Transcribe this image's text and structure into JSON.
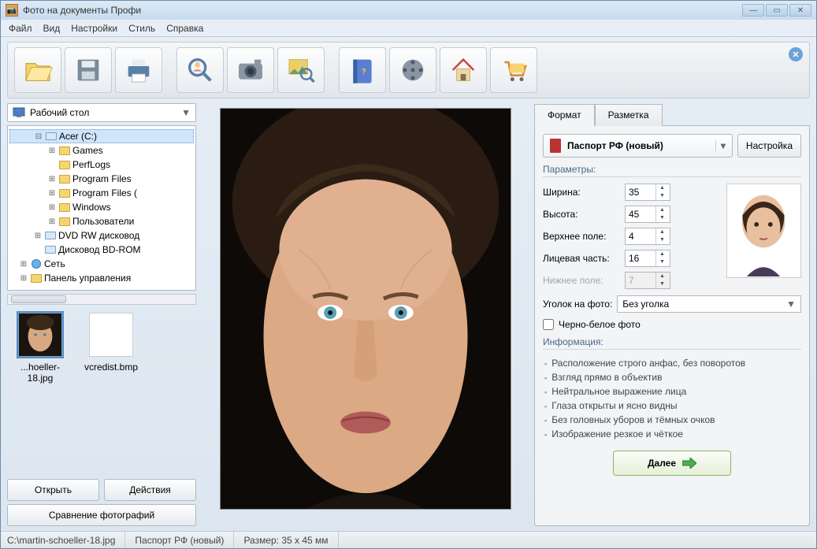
{
  "window": {
    "title": "Фото на документы Профи"
  },
  "menu": {
    "file": "Файл",
    "view": "Вид",
    "settings": "Настройки",
    "style": "Стиль",
    "help": "Справка"
  },
  "location_combo": {
    "label": "Рабочий стол"
  },
  "tree": {
    "acer": "Acer (C:)",
    "games": "Games",
    "perflogs": "PerfLogs",
    "progfiles": "Program Files",
    "progfilesx": "Program Files (",
    "windows": "Windows",
    "users": "Пользователи",
    "dvd": "DVD RW дисковод",
    "bd": "Дисковод BD-ROM",
    "network": "Сеть",
    "control": "Панель управления"
  },
  "thumbs": {
    "file1": "...hoeller-18.jpg",
    "file2": "vcredist.bmp"
  },
  "buttons": {
    "open": "Открыть",
    "actions": "Действия",
    "compare": "Сравнение фотографий"
  },
  "tabs": {
    "format": "Формат",
    "markup": "Разметка"
  },
  "format": {
    "preset_label": "Паспорт РФ (новый)",
    "settings_btn": "Настройка",
    "params_label": "Параметры:",
    "width_label": "Ширина:",
    "width_val": "35",
    "height_label": "Высота:",
    "height_val": "45",
    "top_label": "Верхнее поле:",
    "top_val": "4",
    "face_label": "Лицевая часть:",
    "face_val": "16",
    "bottom_label": "Нижнее поле:",
    "bottom_val": "7",
    "corner_label": "Уголок на фото:",
    "corner_val": "Без уголка",
    "bw_label": "Черно-белое фото",
    "info_label": "Информация:",
    "info_items": [
      "Расположение строго анфас, без поворотов",
      "Взгляд прямо в объектив",
      "Нейтральное выражение лица",
      "Глаза открыты и ясно видны",
      "Без головных уборов и тёмных очков",
      "Изображение резкое и чёткое"
    ],
    "next_btn": "Далее"
  },
  "status": {
    "path": "C:\\martin-schoeller-18.jpg",
    "preset": "Паспорт РФ (новый)",
    "size": "Размер: 35 x 45 мм"
  }
}
